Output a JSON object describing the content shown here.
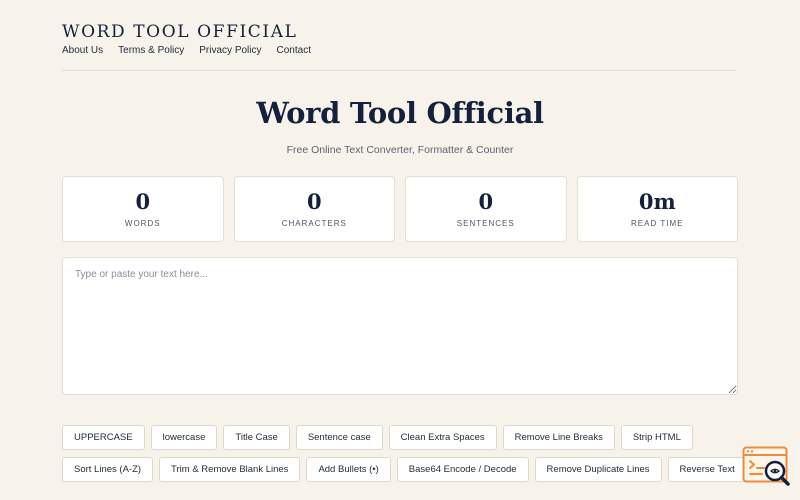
{
  "header": {
    "site_title": "WORD TOOL OFFICIAL",
    "nav": [
      {
        "label": "About Us"
      },
      {
        "label": "Terms & Policy"
      },
      {
        "label": "Privacy Policy"
      },
      {
        "label": "Contact"
      }
    ]
  },
  "hero": {
    "title": "Word Tool Official",
    "subtitle": "Free Online Text Converter, Formatter & Counter"
  },
  "stats": [
    {
      "value": "0",
      "label": "WORDS"
    },
    {
      "value": "0",
      "label": "CHARACTERS"
    },
    {
      "value": "0",
      "label": "SENTENCES"
    },
    {
      "value": "0m",
      "label": "READ TIME"
    }
  ],
  "editor": {
    "placeholder": "Type or paste your text here...",
    "value": ""
  },
  "tools": [
    {
      "label": "UPPERCASE"
    },
    {
      "label": "lowercase"
    },
    {
      "label": "Title Case"
    },
    {
      "label": "Sentence case"
    },
    {
      "label": "Clean Extra Spaces"
    },
    {
      "label": "Remove Line Breaks"
    },
    {
      "label": "Strip HTML"
    },
    {
      "label": "Sort Lines (A-Z)"
    },
    {
      "label": "Trim & Remove Blank Lines"
    },
    {
      "label": "Add Bullets (•)"
    },
    {
      "label": "Base64 Encode / Decode"
    },
    {
      "label": "Remove Duplicate Lines"
    },
    {
      "label": "Reverse Text"
    }
  ],
  "colors": {
    "background": "#f7f3ea",
    "navy": "#14213d",
    "badge_orange": "#f08a3c"
  },
  "badge": {
    "icon": "search-code-icon"
  }
}
